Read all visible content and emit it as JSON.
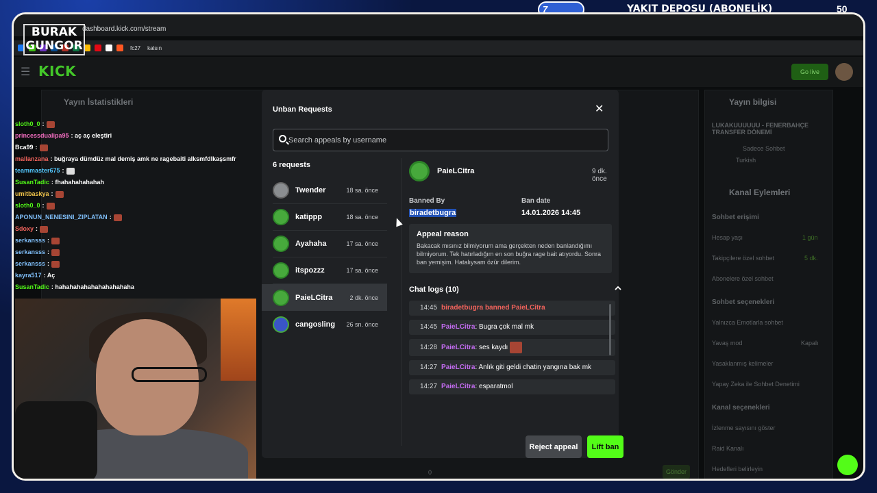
{
  "browser": {
    "url": "dashboard.kick.com/stream",
    "bookmarks": [
      "fc27",
      "kalsın"
    ]
  },
  "overlay": {
    "brand_line1": "BURAK",
    "brand_line2": "GUNGOR",
    "fuel_level": "7",
    "fuel_text": "YAKIT DEPOSU (ABONELİK)",
    "fuel_goal": "50"
  },
  "kick": {
    "logo": "KICK",
    "go_live": "Go live"
  },
  "background": {
    "stats_title": "Yayın İstatistikleri",
    "stream_info_title": "Yayın bilgisi",
    "stream_title": "LUKAKUUUUUU - FENERBAHÇE TRANSFER DÖNEMİ",
    "category": "Sadece Sohbet",
    "tag": "Turkish",
    "channel_actions_title": "Kanal Eylemleri",
    "chat_access": "Sohbet erişimi",
    "account_age": "Hesap yaşı",
    "account_age_val": "1 gün",
    "followers_only": "Takipçilere özel sohbet",
    "followers_only_val": "5 dk.",
    "subs_only": "Abonelere özel sohbet",
    "chat_options": "Sohbet seçenekleri",
    "emote_only": "Yalnızca Emotlarla sohbet",
    "slow_mode": "Yavaş mod",
    "slow_mode_val": "Kapalı",
    "banned_words": "Yasaklanmış kelimeler",
    "ai_moderation": "Yapay Zeka ile Sohbet Denetimi",
    "channel_options": "Kanal seçenekleri",
    "show_viewers": "İzlenme sayısını göster",
    "raid_channel": "Raid Kanalı",
    "set_goals": "Hedefleri belirleyin",
    "send": "Gönder",
    "viewer_count": "0"
  },
  "chat": [
    {
      "user": "sloth0_0",
      "color": "#53fc18",
      "text": ":"
    },
    {
      "user": "princessdualipa95",
      "color": "#f06cbe",
      "text": ": aç aç eleştiri"
    },
    {
      "user": "Bca99",
      "color": "#ffffff",
      "text": ":"
    },
    {
      "user": "mallanzana",
      "color": "#f1635c",
      "text": ": buğraya dümdüz mal demiş amk ne ragebaiti alksmfdlkaşsmfr"
    },
    {
      "user": "teammaster675",
      "color": "#53c7fc",
      "text": ":"
    },
    {
      "user": "SusanTadic",
      "color": "#53fc18",
      "text": ": fhahahahahahah"
    },
    {
      "user": "umitbaskya",
      "color": "#f3c64b",
      "text": ":"
    },
    {
      "user": "sloth0_0",
      "color": "#53fc18",
      "text": ":"
    },
    {
      "user": "APONUN_NENESINI_ZIPLATAN",
      "color": "#7fbef8",
      "text": ":"
    },
    {
      "user": "Sdoxy",
      "color": "#f1635c",
      "text": ":"
    },
    {
      "user": "serkansss",
      "color": "#7fbef8",
      "text": ":"
    },
    {
      "user": "serkansss",
      "color": "#7fbef8",
      "text": ":"
    },
    {
      "user": "serkansss",
      "color": "#7fbef8",
      "text": ":"
    },
    {
      "user": "kayra517",
      "color": "#7fbef8",
      "text": ": Aç"
    },
    {
      "user": "SusanTadic",
      "color": "#53fc18",
      "text": ": hahahahahahahahahahaha"
    }
  ],
  "modal": {
    "title": "Unban Requests",
    "search_placeholder": "Search appeals by username",
    "request_count": "6 requests",
    "requests": [
      {
        "name": "Twender",
        "time": "18 sa. önce"
      },
      {
        "name": "katippp",
        "time": "18 sa. önce"
      },
      {
        "name": "Ayahaha",
        "time": "17 sa. önce"
      },
      {
        "name": "itspozzz",
        "time": "17 sa. önce"
      },
      {
        "name": "PaieLCitra",
        "time": "2 dk. önce"
      },
      {
        "name": "cangosling",
        "time": "26 sn. önce"
      }
    ],
    "detail": {
      "name": "PaieLCitra",
      "time": "9 dk. önce",
      "banned_by_label": "Banned By",
      "banned_by": "biradetbugra",
      "ban_date_label": "Ban date",
      "ban_date": "14.01.2026 14:45",
      "appeal_label": "Appeal reason",
      "appeal_text": "Bakacak mısınız bilmiyorum ama gerçekten neden banlandığımı bilmiyorum. Tek hatırladığım en son buğra rage bait atıyordu. Sonra ban yemişim. Hatalıysam özür dilerim.",
      "chat_logs_label": "Chat logs (10)",
      "logs": [
        {
          "time": "14:45",
          "user": "biradetbugra",
          "text": "banned PaieLCitra",
          "style": "red"
        },
        {
          "time": "14:45",
          "user": "PaieLCitra",
          "text": ": Bugra çok mal mk"
        },
        {
          "time": "14:28",
          "user": "PaieLCitra",
          "text": ": ses kaydı"
        },
        {
          "time": "14:27",
          "user": "PaieLCitra",
          "text": ": Anlık giti geldi chatin yangına bak mk"
        },
        {
          "time": "14:27",
          "user": "PaieLCitra",
          "text": ": esparatmol"
        }
      ]
    },
    "reject_label": "Reject appeal",
    "lift_label": "Lift ban"
  }
}
